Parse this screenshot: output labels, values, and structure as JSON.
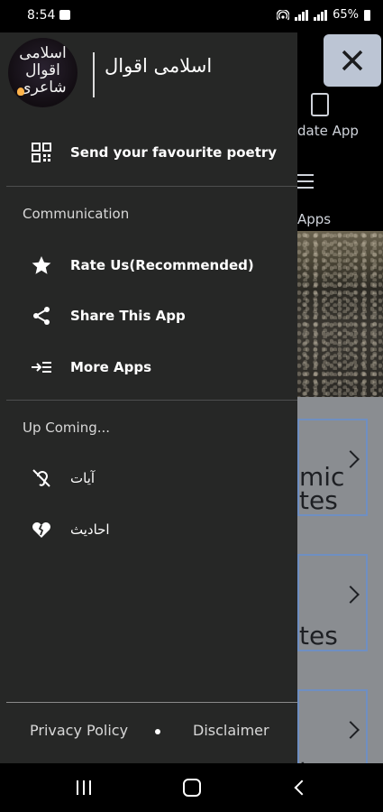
{
  "status_bar": {
    "time": "8:54",
    "battery": "65%"
  },
  "background_app": {
    "close_icon": "close-icon",
    "update_label": "date App",
    "apps_label": "Apps",
    "cards": [
      {
        "text_top": "mic",
        "text_bottom": "tes"
      },
      {
        "text_top": "",
        "text_bottom": "tes"
      },
      {
        "text_top": "",
        "text_bottom": "tes"
      }
    ]
  },
  "drawer": {
    "logo_text": [
      "اسلامی",
      "اقوال",
      "شاعری"
    ],
    "app_title": "اسلامی اقوال",
    "send_poetry": {
      "label": "Send your favourite poetry",
      "icon": "qr-grid-icon"
    },
    "communication": {
      "header": "Communication",
      "items": [
        {
          "label": "Rate Us(Recommended)",
          "icon": "star-icon"
        },
        {
          "label": "Share This App",
          "icon": "share-icon"
        },
        {
          "label": "More Apps",
          "icon": "more-apps-icon"
        }
      ]
    },
    "upcoming": {
      "header": "Up Coming...",
      "items": [
        {
          "label": "آیات",
          "icon": "ear-off-icon"
        },
        {
          "label": "احادیث",
          "icon": "broken-heart-icon"
        }
      ]
    },
    "footer": {
      "privacy": "Privacy Policy",
      "disclaimer": "Disclaimer"
    }
  },
  "nav_bar": {
    "icons": [
      "recents-icon",
      "home-icon",
      "back-icon"
    ]
  }
}
